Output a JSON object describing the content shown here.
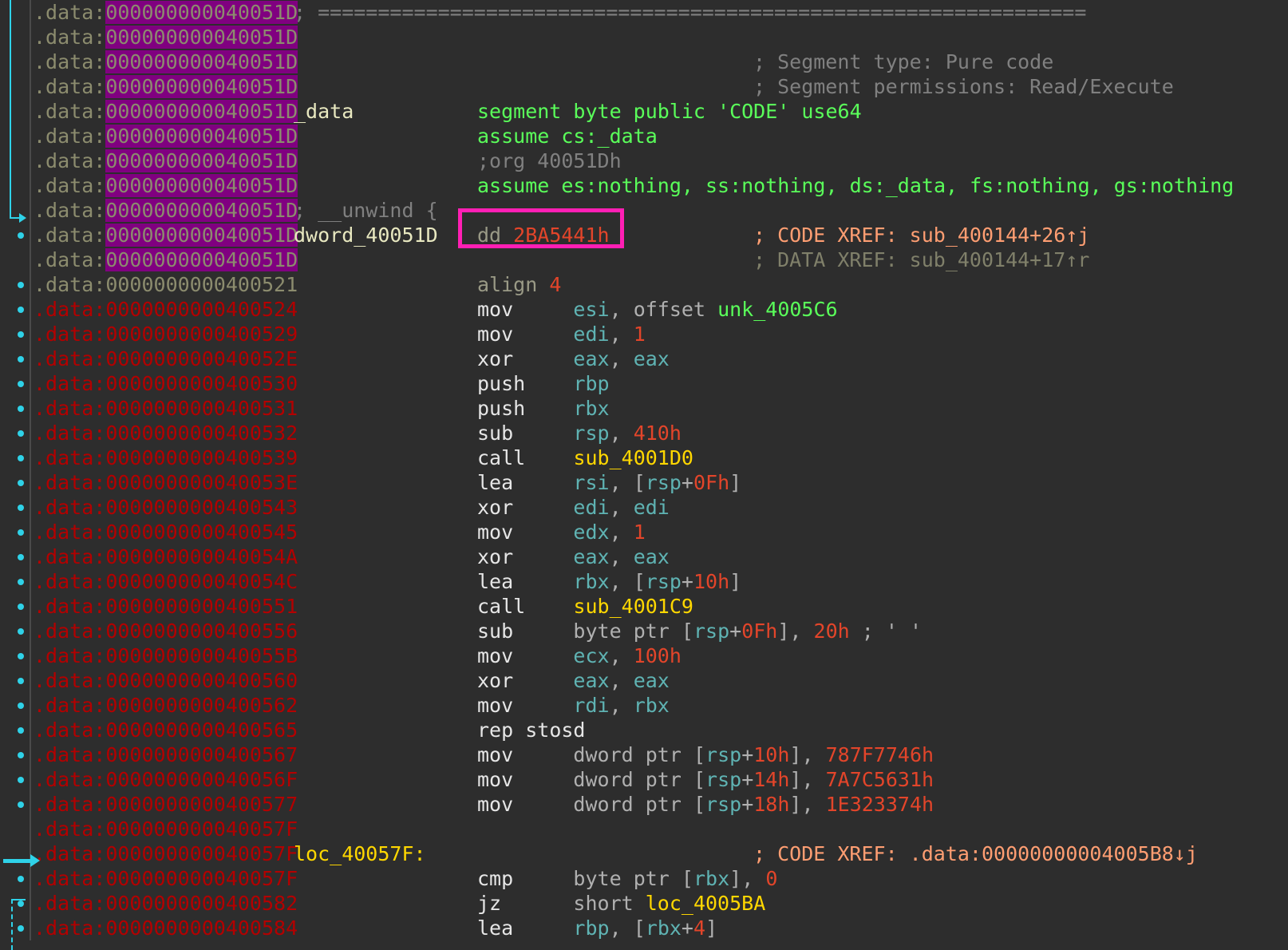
{
  "app": {
    "title": "IDA View-A",
    "segment_prefix": ".data:"
  },
  "annotation": {
    "box_color": "#ff1fb4",
    "box_target": "dd 2BA5441h"
  },
  "colors": {
    "background": "#2d2d2d",
    "highlight_purple": "#800080",
    "address_red": "#b30000",
    "address_tan": "#8c8c6e",
    "directive_green": "#5aff5a",
    "register_teal": "#5fb3b3",
    "number_red": "#e3452a",
    "label_yellow": "#ffd700",
    "xref_orange": "#ff9e72",
    "comment_grey": "#808080",
    "flow_arrow_cyan": "#2fd2e8"
  },
  "lines": [
    {
      "addr": "000000000040051D",
      "addr_style": "tan",
      "highlight": true,
      "bullet": false,
      "label": "",
      "instr": "",
      "comment": "; ================================================================"
    },
    {
      "addr": "000000000040051D",
      "addr_style": "tan",
      "highlight": true,
      "bullet": false,
      "label": "",
      "instr": "",
      "comment": ""
    },
    {
      "addr": "000000000040051D",
      "addr_style": "tan",
      "highlight": true,
      "bullet": false,
      "label": "",
      "instr": "",
      "comment": "; Segment type: Pure code"
    },
    {
      "addr": "000000000040051D",
      "addr_style": "tan",
      "highlight": true,
      "bullet": false,
      "label": "",
      "instr": "",
      "comment": "; Segment permissions: Read/Execute"
    },
    {
      "addr": "000000000040051D",
      "addr_style": "tan",
      "highlight": true,
      "bullet": false,
      "label": "_data",
      "instr": "segment byte public 'CODE' use64",
      "comment": ""
    },
    {
      "addr": "000000000040051D",
      "addr_style": "tan",
      "highlight": true,
      "bullet": false,
      "label": "",
      "instr": "assume cs:_data",
      "comment": ""
    },
    {
      "addr": "000000000040051D",
      "addr_style": "tan",
      "highlight": true,
      "bullet": false,
      "label": "",
      "instr": ";org 40051Dh",
      "comment": ""
    },
    {
      "addr": "000000000040051D",
      "addr_style": "tan",
      "highlight": true,
      "bullet": false,
      "label": "",
      "instr": "assume es:nothing, ss:nothing, ds:_data, fs:nothing, gs:nothing",
      "comment": ""
    },
    {
      "addr": "000000000040051D",
      "addr_style": "tan",
      "highlight": true,
      "bullet": false,
      "label": "; __unwind {",
      "instr": "",
      "comment": ""
    },
    {
      "addr": "000000000040051D",
      "addr_style": "tan",
      "highlight": true,
      "bullet": true,
      "label": "dword_40051D",
      "instr": "dd 2BA5441h",
      "comment": "; CODE XREF: sub_400144+26↑j"
    },
    {
      "addr": "000000000040051D",
      "addr_style": "tan",
      "highlight": true,
      "bullet": false,
      "label": "",
      "instr": "",
      "comment": "; DATA XREF: sub_400144+17↑r"
    },
    {
      "addr": "0000000000400521",
      "addr_style": "tan",
      "highlight": false,
      "bullet": true,
      "label": "",
      "instr": "align 4",
      "comment": ""
    },
    {
      "addr": "0000000000400524",
      "addr_style": "red",
      "highlight": false,
      "bullet": true,
      "label": "",
      "instr": "mov     esi, offset unk_4005C6",
      "comment": ""
    },
    {
      "addr": "0000000000400529",
      "addr_style": "red",
      "highlight": false,
      "bullet": true,
      "label": "",
      "instr": "mov     edi, 1",
      "comment": ""
    },
    {
      "addr": "000000000040052E",
      "addr_style": "red",
      "highlight": false,
      "bullet": true,
      "label": "",
      "instr": "xor     eax, eax",
      "comment": ""
    },
    {
      "addr": "0000000000400530",
      "addr_style": "red",
      "highlight": false,
      "bullet": true,
      "label": "",
      "instr": "push    rbp",
      "comment": ""
    },
    {
      "addr": "0000000000400531",
      "addr_style": "red",
      "highlight": false,
      "bullet": true,
      "label": "",
      "instr": "push    rbx",
      "comment": ""
    },
    {
      "addr": "0000000000400532",
      "addr_style": "red",
      "highlight": false,
      "bullet": true,
      "label": "",
      "instr": "sub     rsp, 410h",
      "comment": ""
    },
    {
      "addr": "0000000000400539",
      "addr_style": "red",
      "highlight": false,
      "bullet": true,
      "label": "",
      "instr": "call    sub_4001D0",
      "comment": ""
    },
    {
      "addr": "000000000040053E",
      "addr_style": "red",
      "highlight": false,
      "bullet": true,
      "label": "",
      "instr": "lea     rsi, [rsp+0Fh]",
      "comment": ""
    },
    {
      "addr": "0000000000400543",
      "addr_style": "red",
      "highlight": false,
      "bullet": true,
      "label": "",
      "instr": "xor     edi, edi",
      "comment": ""
    },
    {
      "addr": "0000000000400545",
      "addr_style": "red",
      "highlight": false,
      "bullet": true,
      "label": "",
      "instr": "mov     edx, 1",
      "comment": ""
    },
    {
      "addr": "000000000040054A",
      "addr_style": "red",
      "highlight": false,
      "bullet": true,
      "label": "",
      "instr": "xor     eax, eax",
      "comment": ""
    },
    {
      "addr": "000000000040054C",
      "addr_style": "red",
      "highlight": false,
      "bullet": true,
      "label": "",
      "instr": "lea     rbx, [rsp+10h]",
      "comment": ""
    },
    {
      "addr": "0000000000400551",
      "addr_style": "red",
      "highlight": false,
      "bullet": true,
      "label": "",
      "instr": "call    sub_4001C9",
      "comment": ""
    },
    {
      "addr": "0000000000400556",
      "addr_style": "red",
      "highlight": false,
      "bullet": true,
      "label": "",
      "instr": "sub     byte ptr [rsp+0Fh], 20h ; ' '",
      "comment": ""
    },
    {
      "addr": "000000000040055B",
      "addr_style": "red",
      "highlight": false,
      "bullet": true,
      "label": "",
      "instr": "mov     ecx, 100h",
      "comment": ""
    },
    {
      "addr": "0000000000400560",
      "addr_style": "red",
      "highlight": false,
      "bullet": true,
      "label": "",
      "instr": "xor     eax, eax",
      "comment": ""
    },
    {
      "addr": "0000000000400562",
      "addr_style": "red",
      "highlight": false,
      "bullet": true,
      "label": "",
      "instr": "mov     rdi, rbx",
      "comment": ""
    },
    {
      "addr": "0000000000400565",
      "addr_style": "red",
      "highlight": false,
      "bullet": true,
      "label": "",
      "instr": "rep stosd",
      "comment": ""
    },
    {
      "addr": "0000000000400567",
      "addr_style": "red",
      "highlight": false,
      "bullet": true,
      "label": "",
      "instr": "mov     dword ptr [rsp+10h], 787F7746h",
      "comment": ""
    },
    {
      "addr": "000000000040056F",
      "addr_style": "red",
      "highlight": false,
      "bullet": true,
      "label": "",
      "instr": "mov     dword ptr [rsp+14h], 7A7C5631h",
      "comment": ""
    },
    {
      "addr": "0000000000400577",
      "addr_style": "red",
      "highlight": false,
      "bullet": true,
      "label": "",
      "instr": "mov     dword ptr [rsp+18h], 1E323374h",
      "comment": ""
    },
    {
      "addr": "000000000040057F",
      "addr_style": "red",
      "highlight": false,
      "bullet": false,
      "label": "",
      "instr": "",
      "comment": ""
    },
    {
      "addr": "000000000040057F",
      "addr_style": "red",
      "highlight": false,
      "bullet": false,
      "label": "loc_40057F:",
      "instr": "",
      "comment": "; CODE XREF: .data:00000000004005B8↓j"
    },
    {
      "addr": "000000000040057F",
      "addr_style": "red",
      "highlight": false,
      "bullet": true,
      "label": "",
      "instr": "cmp     byte ptr [rbx], 0",
      "comment": ""
    },
    {
      "addr": "0000000000400582",
      "addr_style": "red",
      "highlight": false,
      "bullet": true,
      "label": "",
      "instr": "jz      short loc_4005BA",
      "comment": ""
    },
    {
      "addr": "0000000000400584",
      "addr_style": "red",
      "highlight": false,
      "bullet": true,
      "label": "",
      "instr": "lea     rbp, [rbx+4]",
      "comment": ""
    }
  ]
}
